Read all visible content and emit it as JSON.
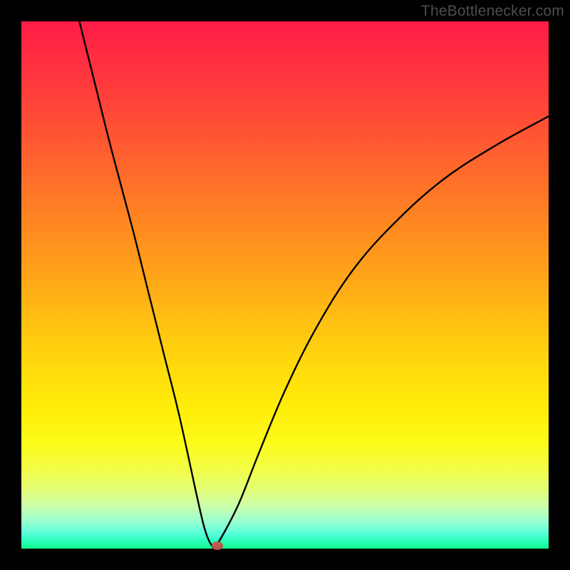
{
  "watermark": "TheBottlenecker.com",
  "chart_data": {
    "type": "line",
    "title": "",
    "xlabel": "",
    "ylabel": "",
    "xlim": [
      0,
      100
    ],
    "ylim": [
      0,
      100
    ],
    "series": [
      {
        "name": "bottleneck-curve",
        "x": [
          11,
          14,
          17,
          21,
          24,
          27,
          30,
          33.5,
          35,
          36.2,
          37,
          41,
          45,
          50,
          56,
          63,
          71,
          80,
          90,
          100
        ],
        "values": [
          100,
          88,
          76,
          61,
          49,
          37,
          25,
          9,
          3,
          0.5,
          0.6,
          8,
          18,
          30,
          42,
          53,
          62,
          70,
          76.5,
          82
        ]
      }
    ],
    "marker": {
      "x": 37.2,
      "y": 0.5,
      "name": "minimum-point"
    },
    "colors": {
      "gradient_top": "#ff1b47",
      "gradient_bottom": "#10f789",
      "curve": "#000000",
      "background": "#000000",
      "marker": "#b85b4e"
    }
  }
}
